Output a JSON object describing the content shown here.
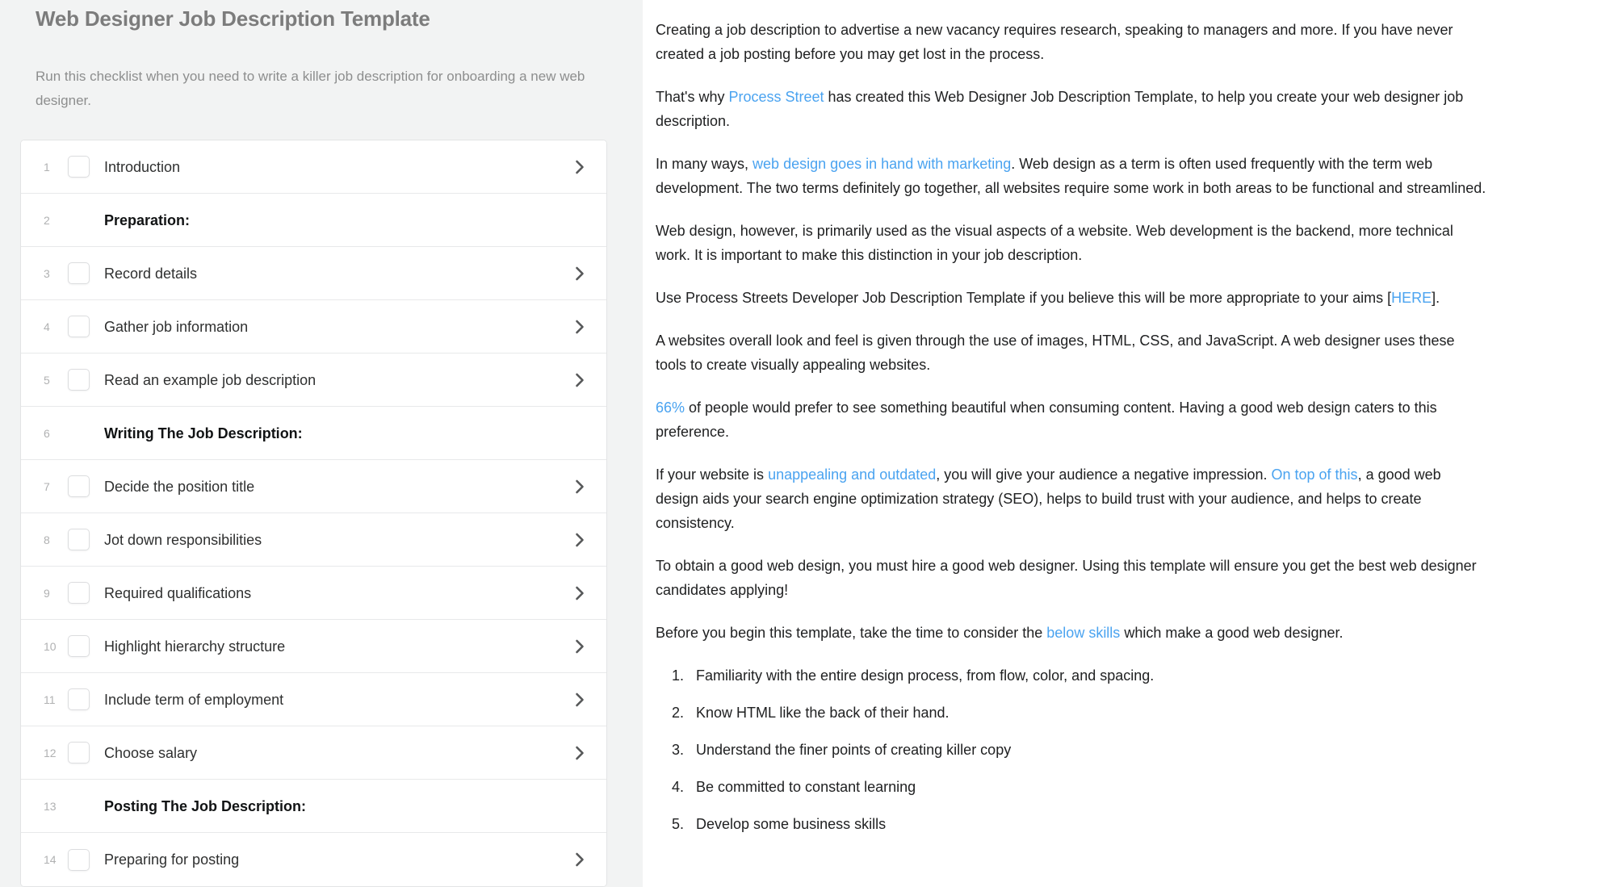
{
  "checklist": {
    "title": "Web Designer Job Description Template",
    "description": "Run this checklist when you need to write a killer job description for onboarding a new web designer.",
    "tasks": [
      {
        "index": "1",
        "label": "Introduction",
        "type": "task"
      },
      {
        "index": "2",
        "label": "Preparation:",
        "type": "header"
      },
      {
        "index": "3",
        "label": "Record details",
        "type": "task"
      },
      {
        "index": "4",
        "label": "Gather job information",
        "type": "task"
      },
      {
        "index": "5",
        "label": "Read an example job description",
        "type": "task"
      },
      {
        "index": "6",
        "label": "Writing The Job Description:",
        "type": "header"
      },
      {
        "index": "7",
        "label": "Decide the position title",
        "type": "task"
      },
      {
        "index": "8",
        "label": "Jot down responsibilities",
        "type": "task"
      },
      {
        "index": "9",
        "label": "Required qualifications",
        "type": "task"
      },
      {
        "index": "10",
        "label": "Highlight hierarchy structure",
        "type": "task"
      },
      {
        "index": "11",
        "label": "Include term of employment",
        "type": "task"
      },
      {
        "index": "12",
        "label": "Choose salary",
        "type": "task"
      },
      {
        "index": "13",
        "label": "Posting The Job Description:",
        "type": "header"
      },
      {
        "index": "14",
        "label": "Preparing for posting",
        "type": "task"
      }
    ]
  },
  "content": {
    "paragraphs": [
      {
        "id": "p1",
        "parts": [
          {
            "text": "Creating a job description to advertise a new vacancy requires research, speaking to managers and more. If you have never created a job posting before you may get lost in the process.",
            "link": false
          }
        ]
      },
      {
        "id": "p2",
        "parts": [
          {
            "text": "That's why ",
            "link": false
          },
          {
            "text": "Process Street",
            "link": true
          },
          {
            "text": " has created this Web Designer Job Description Template, to help you create your web designer job description.",
            "link": false
          }
        ]
      },
      {
        "id": "p3",
        "parts": [
          {
            "text": "In many ways, ",
            "link": false
          },
          {
            "text": "web design goes in hand with marketing",
            "link": true
          },
          {
            "text": ". Web design as a term is often used frequently with the term web development. The two terms definitely go together, all websites require some work in both areas to be functional and streamlined.",
            "link": false
          }
        ]
      },
      {
        "id": "p4",
        "parts": [
          {
            "text": "Web design, however, is primarily used as the visual aspects of a website. Web development is the backend, more technical work. It is important to make this distinction in your job description.",
            "link": false
          }
        ]
      },
      {
        "id": "p5",
        "parts": [
          {
            "text": "Use Process Streets Developer Job Description Template if you believe this will be more appropriate to your aims [",
            "link": false
          },
          {
            "text": "HERE",
            "link": true
          },
          {
            "text": "].",
            "link": false
          }
        ]
      },
      {
        "id": "p6",
        "parts": [
          {
            "text": "A websites overall look and feel is given through the use of images, HTML, CSS, and JavaScript. A web designer uses these tools to create visually appealing websites.",
            "link": false
          }
        ]
      },
      {
        "id": "p7",
        "parts": [
          {
            "text": "66%",
            "link": true
          },
          {
            "text": " of people would prefer to see something beautiful when consuming content. Having a good web design caters to this preference.",
            "link": false
          }
        ]
      },
      {
        "id": "p8",
        "parts": [
          {
            "text": "If your website is ",
            "link": false
          },
          {
            "text": "unappealing and outdated",
            "link": true
          },
          {
            "text": ", you will give your audience a negative impression. ",
            "link": false
          },
          {
            "text": "On top of this",
            "link": true
          },
          {
            "text": ", a good web design aids your search engine optimization strategy (SEO), helps to build trust with your audience, and helps to create consistency.",
            "link": false
          }
        ]
      },
      {
        "id": "p9",
        "parts": [
          {
            "text": "To obtain a good web design, you must hire a good web designer. Using this template will ensure you get the best web designer candidates applying!",
            "link": false
          }
        ]
      },
      {
        "id": "p10",
        "parts": [
          {
            "text": "Before you begin this template, take the time to consider the ",
            "link": false
          },
          {
            "text": "below skills",
            "link": true
          },
          {
            "text": " which make a good web designer.",
            "link": false
          }
        ]
      }
    ],
    "skills_list": [
      "Familiarity with the entire design process, from flow, color, and spacing.",
      "Know HTML like the back of their hand.",
      "Understand the finer points of creating killer copy",
      "Be committed to constant learning",
      "Develop some business skills"
    ]
  },
  "colors": {
    "link": "#4aa3f0",
    "panel_bg": "#f2f3f3",
    "title": "#7c7c7c",
    "body_text": "#202122"
  }
}
